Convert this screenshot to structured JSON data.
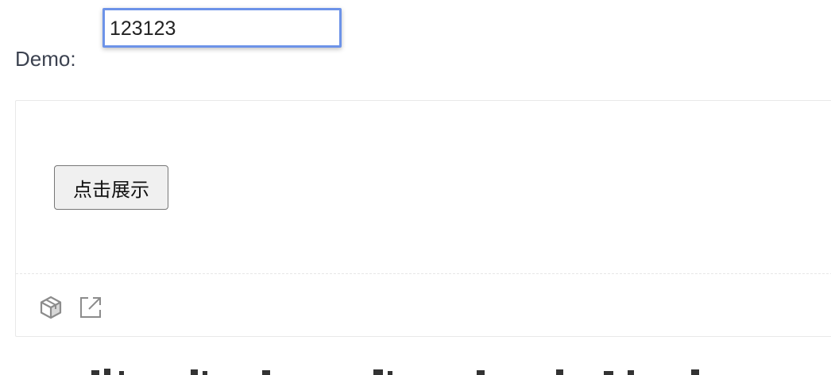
{
  "overlay_input": {
    "value": "123123"
  },
  "demo": {
    "label": "Demo:",
    "button_label": "点击展示"
  },
  "actions": {
    "icons": [
      "codesandbox-icon",
      "external-link-icon"
    ]
  },
  "colors": {
    "input_focus_border": "#6d93e8",
    "label_text": "#3c4250",
    "icon_gray": "#8c8c8c",
    "box_border": "#e8e8e8"
  }
}
